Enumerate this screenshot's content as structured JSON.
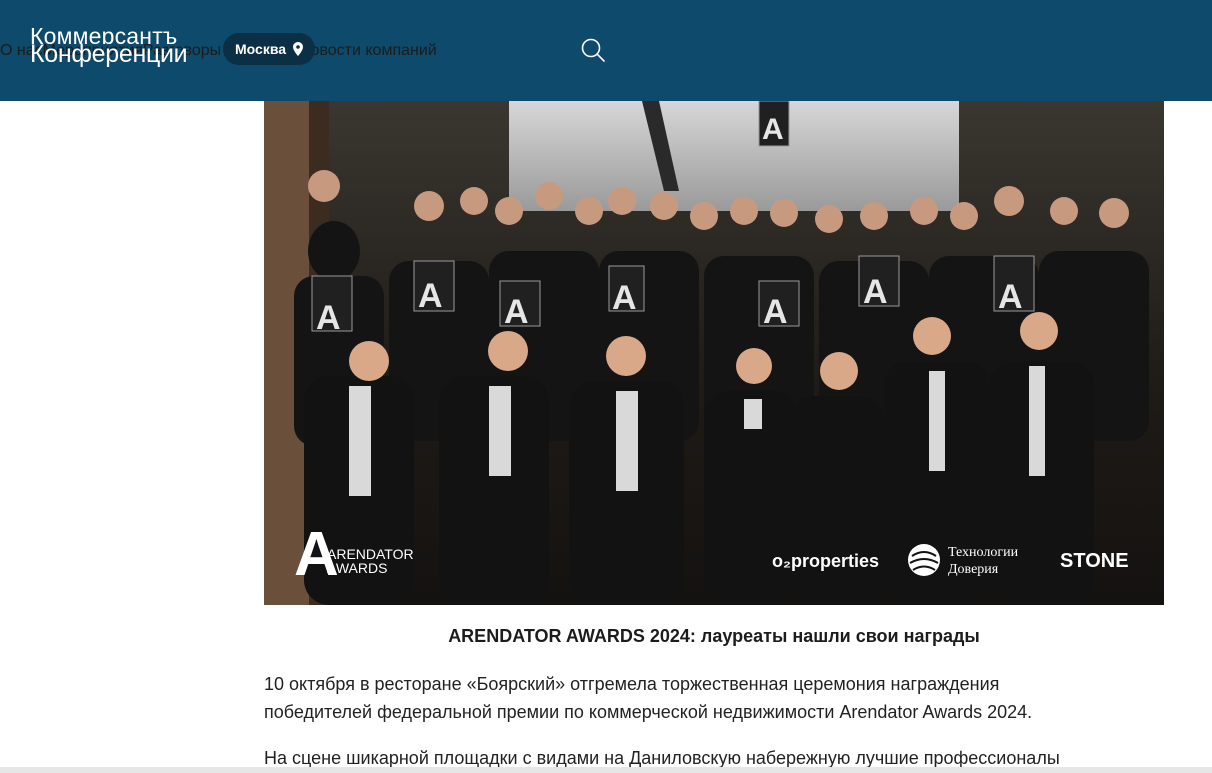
{
  "header": {
    "logo_line1": "Коммерсантъ",
    "logo_line2": "Конференции",
    "city": "Москва",
    "nav": [
      "О нас",
      "Мероприятия",
      "Разговоры о бизнесе",
      "Новости компаний"
    ],
    "background": "#0d4a6b"
  },
  "photo": {
    "logo_letter": "A",
    "logo_text_1": "ARENDATOR",
    "logo_text_2": "AWARDS",
    "sponsor_1": "o₂properties",
    "sponsor_2_line1": "Технологии",
    "sponsor_2_line2": "Доверия",
    "sponsor_3": "STONE"
  },
  "article": {
    "caption": "ARENDATOR AWARDS 2024: лауреаты нашли свои награды",
    "paragraph_1_line1": "10 октября в ресторане «Боярский» отгремела торжественная церемония награждения",
    "paragraph_1_line2": "победителей федеральной премии по коммерческой недвижимости Arendator Awards 2024.",
    "paragraph_2_line1": "На сцене шикарной площадки с видами на Даниловскую набережную лучшие профессионалы"
  }
}
